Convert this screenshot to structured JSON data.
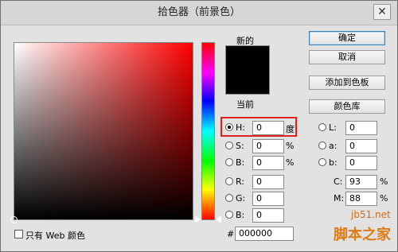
{
  "window": {
    "title": "拾色器（前景色）",
    "close_glyph": "✕"
  },
  "preview": {
    "new_label": "新的",
    "current_label": "当前"
  },
  "buttons": {
    "ok": "确定",
    "cancel": "取消",
    "add_swatch": "添加到色板",
    "libraries": "颜色库"
  },
  "hsb": {
    "h": {
      "label": "H:",
      "value": "0",
      "unit": "度",
      "selected": true
    },
    "s": {
      "label": "S:",
      "value": "0",
      "unit": "%"
    },
    "b": {
      "label": "B:",
      "value": "0",
      "unit": "%"
    }
  },
  "rgb": {
    "r": {
      "label": "R:",
      "value": "0"
    },
    "g": {
      "label": "G:",
      "value": "0"
    },
    "b": {
      "label": "B:",
      "value": "0"
    }
  },
  "lab": {
    "l": {
      "label": "L:",
      "value": "0"
    },
    "a": {
      "label": "a:",
      "value": "0"
    },
    "b": {
      "label": "b:",
      "value": "0"
    }
  },
  "cmyk": {
    "c": {
      "label": "C:",
      "value": "93",
      "unit": "%"
    },
    "m": {
      "label": "M:",
      "value": "88",
      "unit": "%"
    }
  },
  "hex": {
    "label": "#",
    "value": "000000"
  },
  "web_only": {
    "label": "只有 Web 颜色",
    "checked": false
  },
  "watermark": {
    "site": "jb51.net",
    "brand": "脚本之家"
  },
  "colors": {
    "current": "#000000",
    "highlight": "#e0211b"
  }
}
